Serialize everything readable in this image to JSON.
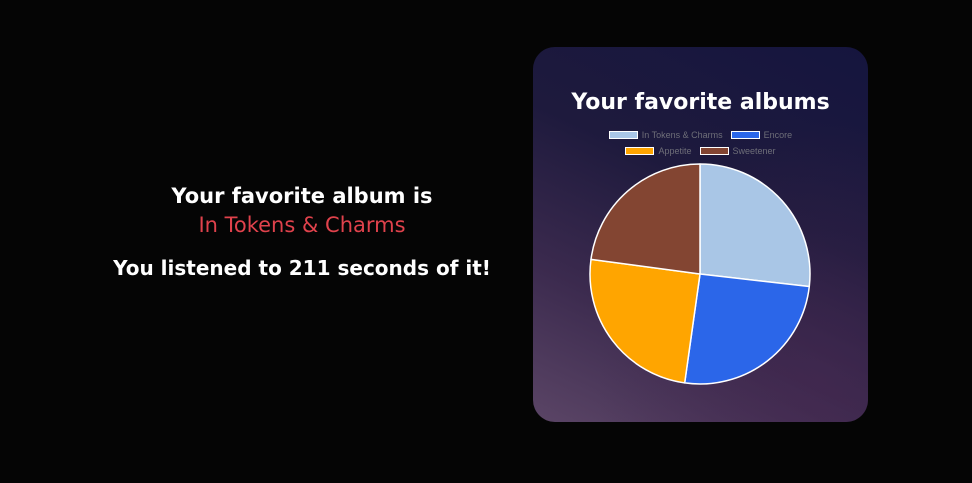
{
  "summary": {
    "line1": "Your favorite album is",
    "album": "In Tokens & Charms",
    "line2": "You listened to 211 seconds of it!"
  },
  "card": {
    "title": "Your favorite albums"
  },
  "colors": {
    "accent_album": "#e0424c",
    "slice_border": "#ffffff"
  },
  "chart_data": {
    "type": "pie",
    "title": "Your favorite albums",
    "legend_position": "top",
    "categories": [
      "In Tokens & Charms",
      "Encore",
      "Appetite",
      "Sweetener"
    ],
    "values": [
      211,
      200,
      196,
      180
    ],
    "colors": [
      "#a9c6e6",
      "#2b66e9",
      "#ffa500",
      "#834532"
    ],
    "start_angle_deg": -90
  }
}
